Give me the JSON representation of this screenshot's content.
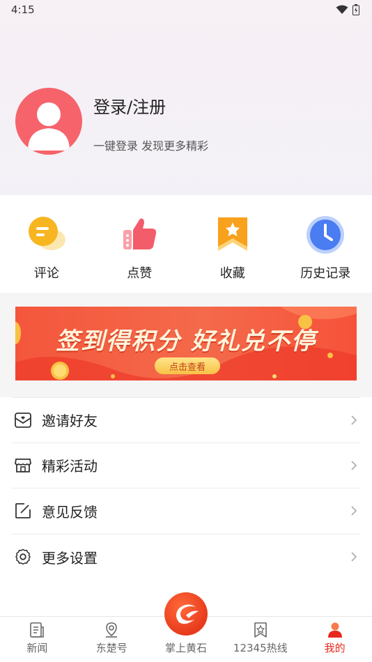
{
  "status_bar": {
    "time": "4:15"
  },
  "profile": {
    "title": "登录/注册",
    "subtitle": "一键登录 发现更多精彩"
  },
  "quick_actions": [
    {
      "label": "评论",
      "icon": "comment-icon",
      "color": "#f7b520"
    },
    {
      "label": "点赞",
      "icon": "thumbs-up-icon",
      "color": "#f35c6a"
    },
    {
      "label": "收藏",
      "icon": "bookmark-icon",
      "color": "#f8a11c"
    },
    {
      "label": "历史记录",
      "icon": "clock-icon",
      "color": "#4a7cf2"
    }
  ],
  "banner": {
    "title": "签到得积分  好礼兑不停",
    "button": "点击查看"
  },
  "menu": [
    {
      "label": "邀请好友",
      "icon": "invite-mail-icon"
    },
    {
      "label": "精彩活动",
      "icon": "shop-icon"
    },
    {
      "label": "意见反馈",
      "icon": "edit-icon"
    },
    {
      "label": "更多设置",
      "icon": "settings-gear-icon"
    }
  ],
  "tabbar": {
    "items": [
      {
        "label": "新闻",
        "icon": "news-doc-icon"
      },
      {
        "label": "东楚号",
        "icon": "location-pin-icon"
      },
      {
        "label": "掌上黄石",
        "icon": "app-logo-icon"
      },
      {
        "label": "12345热线",
        "icon": "hotline-icon"
      },
      {
        "label": "我的",
        "icon": "user-icon"
      }
    ],
    "active_index": 4,
    "active_color": "#e8281f"
  }
}
